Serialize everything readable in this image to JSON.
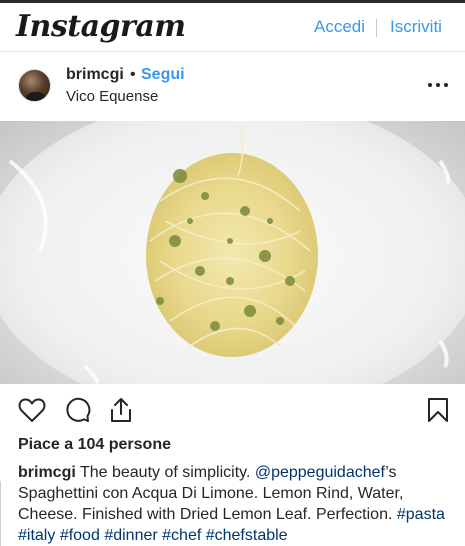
{
  "header": {
    "logo_text": "Instagram",
    "login_label": "Accedi",
    "signup_label": "Iscriviti"
  },
  "post": {
    "username": "brimcgi",
    "separator": "•",
    "follow_label": "Segui",
    "location": "Vico Equense",
    "image_alt": "Spaghettini con Acqua Di Limone",
    "likes_text": "Piace a 104 persone",
    "caption": {
      "username": "brimcgi",
      "text_1": "The beauty of simplicity.",
      "mention": "@peppeguidachef",
      "text_2": "’s Spaghettini con Acqua Di Limone. Lemon Rind, Water, Cheese. Finished with Dried Lemon Leaf. Perfection.",
      "hashtags": [
        "#pasta",
        "#italy",
        "#food",
        "#dinner",
        "#chef",
        "#chefstable"
      ]
    }
  },
  "icons": {
    "more": "more-options-icon",
    "like": "heart-icon",
    "comment": "comment-icon",
    "share": "share-icon",
    "save": "bookmark-icon"
  },
  "colors": {
    "link": "#3897f0",
    "hashtag": "#003569",
    "text": "#262626"
  }
}
